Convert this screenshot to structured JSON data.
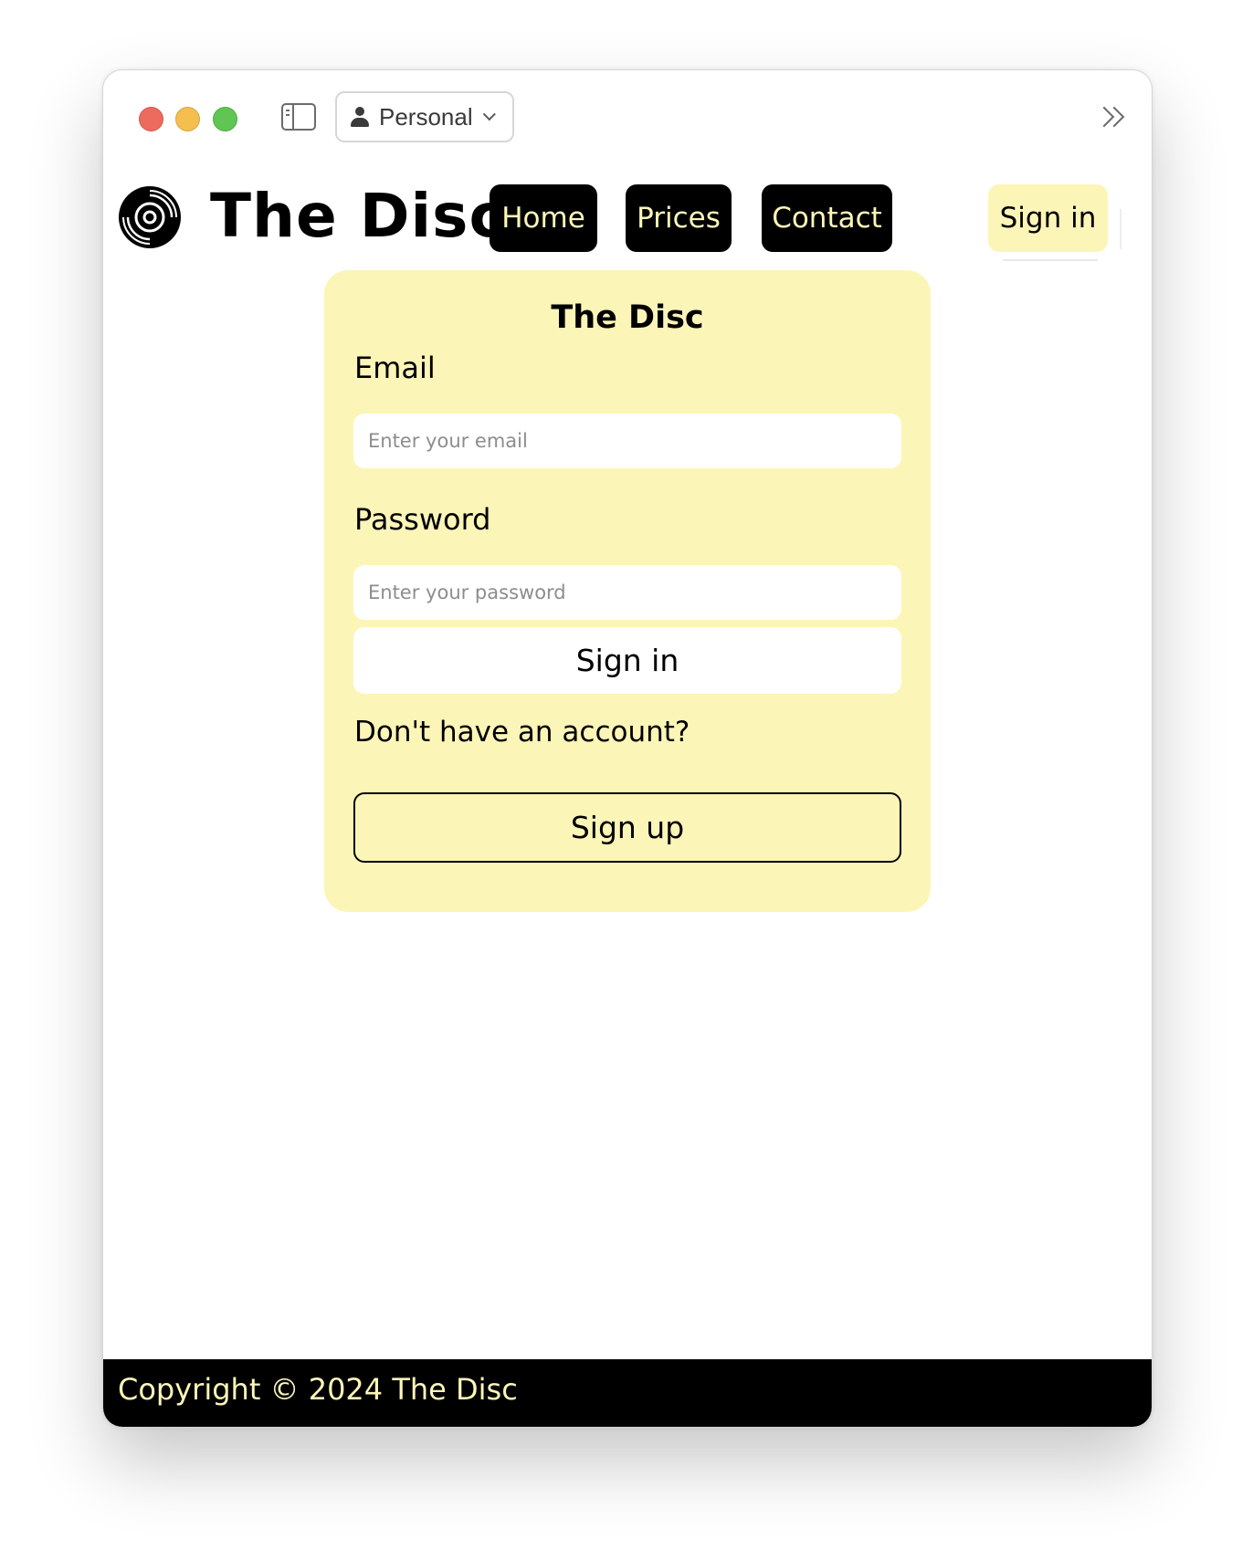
{
  "browser": {
    "profile_label": "Personal",
    "icons": {
      "close": "close-button",
      "minimize": "minimize-button",
      "maximize": "maximize-button",
      "sidebar": "sidebar-toggle-icon",
      "profile": "person-icon",
      "chevron": "chevron-down-icon",
      "more": "double-chevron-right-icon"
    }
  },
  "header": {
    "brand": "The Disc",
    "logo_icon": "vinyl-disc-icon",
    "nav": [
      {
        "label": "Home"
      },
      {
        "label": "Prices"
      },
      {
        "label": "Contact"
      }
    ],
    "signin_label": "Sign in"
  },
  "form": {
    "title": "The Disc",
    "email_label": "Email",
    "email_placeholder": "Enter your email",
    "email_value": "",
    "password_label": "Password",
    "password_placeholder": "Enter your password",
    "password_value": "",
    "signin_label": "Sign in",
    "no_account_text": "Don't have an account?",
    "signup_label": "Sign up"
  },
  "footer": {
    "copyright": "Copyright © 2024 The Disc"
  },
  "colors": {
    "accent_yellow": "#fcf5b8",
    "nav_bg": "#000000",
    "nav_text": "#fdf6b8",
    "footer_bg": "#000000"
  }
}
